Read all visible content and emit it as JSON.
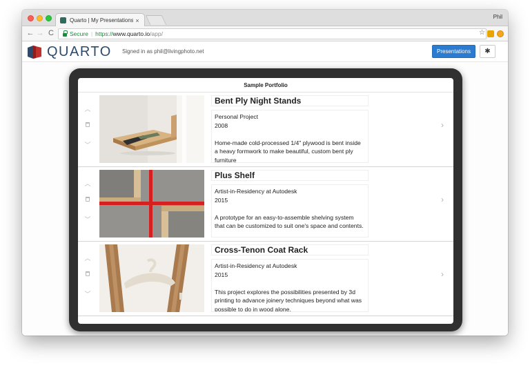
{
  "browser": {
    "tab_title": "Quarto | My Presentations",
    "tab_close": "×",
    "user_name": "Phil",
    "nav": {
      "back": "←",
      "forward": "→",
      "reload": "C"
    },
    "address": {
      "secure_label": "Secure",
      "separator": "|",
      "scheme": "https://",
      "host": "www.quarto.io",
      "path": "/app/"
    },
    "star": "☆"
  },
  "app": {
    "brand": "QUARTO",
    "signed_in": "Signed in as phil@livingphoto.net",
    "presentations_label": "Presentations",
    "settings_glyph": "✱"
  },
  "portfolio": {
    "title": "Sample Portfolio",
    "items": [
      {
        "title": "Bent Ply Night Stands",
        "context": "Personal Project",
        "year": "2008",
        "description": "Home-made cold-processed 1/4\" plywood is bent inside a heavy formwork to make beautiful, custom bent ply furniture"
      },
      {
        "title": "Plus Shelf",
        "context": "Artist-in-Residency at Autodesk",
        "year": "2015",
        "description": "A prototype for an easy-to-assemble shelving system that can be customized to suit one's space and contents."
      },
      {
        "title": "Cross-Tenon Coat Rack",
        "context": "Artist-in-Residency at Autodesk",
        "year": "2015",
        "description": "This project explores the possibilities presented by 3d printing to advance joinery techniques beyond what was possible to do in wood alone."
      }
    ],
    "controls": {
      "up": "︿",
      "down": "﹀",
      "next": "›"
    }
  },
  "colors": {
    "primary_button": "#2b7bd0",
    "brand_navy": "#2d4a6b",
    "logo_red": "#c0312d",
    "secure_green": "#1c8a3b",
    "device_frame": "#303030"
  }
}
